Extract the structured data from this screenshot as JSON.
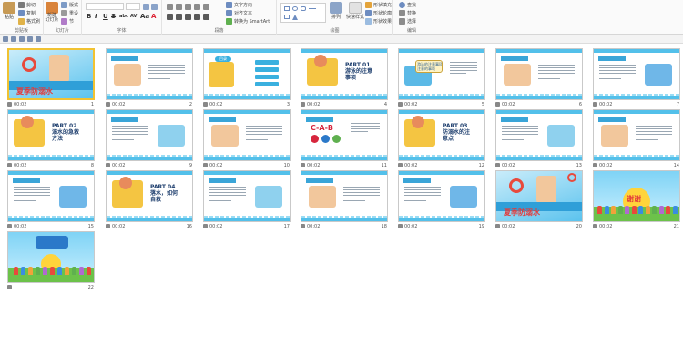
{
  "ribbon": {
    "clipboard": {
      "label": "剪贴板",
      "paste": "粘贴",
      "cut": "剪切",
      "copy": "复制",
      "format_painter": "格式刷"
    },
    "slides": {
      "label": "幻灯片",
      "new_slide": "新建\n幻灯片",
      "layout": "版式",
      "reset": "重设",
      "section": "节"
    },
    "font": {
      "label": "字体",
      "bold": "B",
      "italic": "I",
      "underline": "U",
      "strike": "S",
      "shadow": "abc",
      "spacing": "AV",
      "case": "Aa",
      "color": "A"
    },
    "paragraph": {
      "label": "段落",
      "text_direction": "文字方向",
      "align_text": "对齐文本",
      "smartart": "转换为 SmartArt"
    },
    "drawing": {
      "label": "绘图",
      "arrange": "排列",
      "quick_styles": "快速样式",
      "shape_fill": "形状填充",
      "shape_outline": "形状轮廓",
      "shape_effects": "形状效果"
    },
    "editing": {
      "label": "编辑",
      "find": "查找",
      "replace": "替换",
      "select": "选择"
    }
  },
  "slides": [
    {
      "num": "1",
      "time": "00:02",
      "kind": "cover",
      "selected": true,
      "title": "夏季防溺水"
    },
    {
      "num": "2",
      "time": "00:02",
      "kind": "text-pic"
    },
    {
      "num": "3",
      "time": "00:02",
      "kind": "toc",
      "chip": "目录"
    },
    {
      "num": "4",
      "time": "00:02",
      "kind": "part",
      "text": "PART 01\n游泳的注意\n事项"
    },
    {
      "num": "5",
      "time": "00:02",
      "kind": "wave-box",
      "box": "游泳的注意事项\n注意的事项"
    },
    {
      "num": "6",
      "time": "00:02",
      "kind": "text-pic"
    },
    {
      "num": "7",
      "time": "00:02",
      "kind": "text-pic"
    },
    {
      "num": "8",
      "time": "00:02",
      "kind": "part",
      "text": "PART 02\n溺水的急救\n方法"
    },
    {
      "num": "9",
      "time": "00:02",
      "kind": "text-pic"
    },
    {
      "num": "10",
      "time": "00:02",
      "kind": "text-pic"
    },
    {
      "num": "11",
      "time": "00:02",
      "kind": "cab",
      "text": "C-A-B"
    },
    {
      "num": "12",
      "time": "00:02",
      "kind": "part",
      "text": "PART 03\n防溺水的注\n意点"
    },
    {
      "num": "13",
      "time": "00:02",
      "kind": "text-pic"
    },
    {
      "num": "14",
      "time": "00:02",
      "kind": "text-pic"
    },
    {
      "num": "15",
      "time": "00:02",
      "kind": "text-pic"
    },
    {
      "num": "16",
      "time": "00:02",
      "kind": "part",
      "text": "PART 04\n落水，如何\n自救"
    },
    {
      "num": "17",
      "time": "00:02",
      "kind": "text-pic"
    },
    {
      "num": "18",
      "time": "00:02",
      "kind": "text-pic"
    },
    {
      "num": "19",
      "time": "00:02",
      "kind": "text-pic"
    },
    {
      "num": "20",
      "time": "00:02",
      "kind": "cover",
      "title": "夏季防溺水"
    },
    {
      "num": "21",
      "time": "00:02",
      "kind": "thanks",
      "text": "谢谢"
    },
    {
      "num": "22",
      "time": "",
      "kind": "ending"
    }
  ]
}
